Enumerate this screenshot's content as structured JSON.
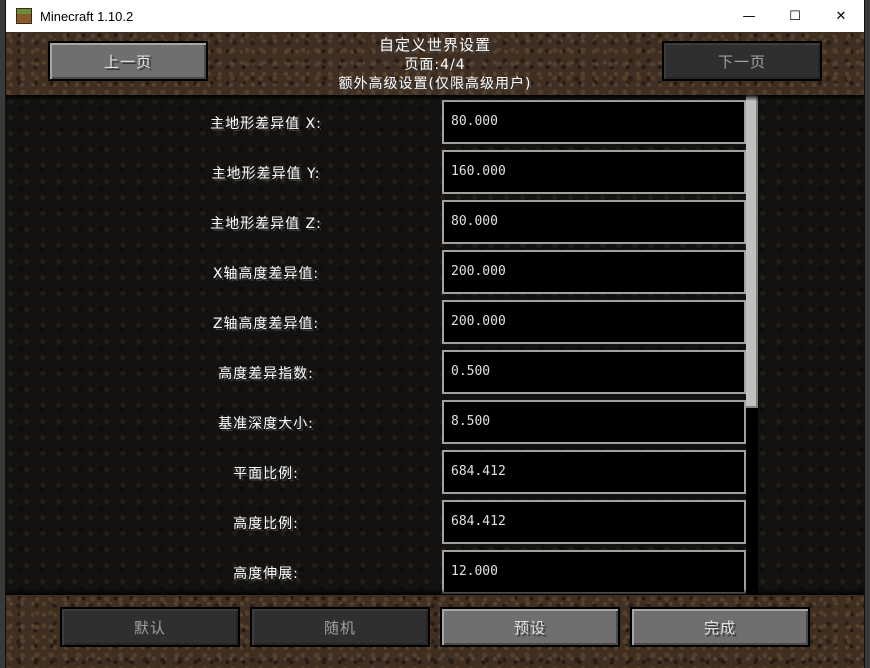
{
  "window": {
    "title": "Minecraft 1.10.2",
    "controls": {
      "minimize": "—",
      "maximize": "☐",
      "close": "✕"
    }
  },
  "header": {
    "title": "自定义世界设置",
    "page": "页面:4/4",
    "subtitle": "额外高级设置(仅限高级用户)",
    "prev_label": "上一页",
    "next_label": "下一页"
  },
  "settings": [
    {
      "label": "主地形差异值 X:",
      "value": "80.000"
    },
    {
      "label": "主地形差异值 Y:",
      "value": "160.000"
    },
    {
      "label": "主地形差异值 Z:",
      "value": "80.000"
    },
    {
      "label": "X轴高度差异值:",
      "value": "200.000"
    },
    {
      "label": "Z轴高度差异值:",
      "value": "200.000"
    },
    {
      "label": "高度差异指数:",
      "value": "0.500"
    },
    {
      "label": "基准深度大小:",
      "value": "8.500"
    },
    {
      "label": "平面比例:",
      "value": "684.412"
    },
    {
      "label": "高度比例:",
      "value": "684.412"
    },
    {
      "label": "高度伸展:",
      "value": "12.000"
    }
  ],
  "footer": {
    "default_label": "默认",
    "random_label": "随机",
    "presets_label": "预设",
    "done_label": "完成"
  },
  "colors": {
    "text": "#ffffff",
    "field_border": "#a0a0a0",
    "button": "#6f6f6f",
    "button_disabled": "#2f2f2f"
  }
}
